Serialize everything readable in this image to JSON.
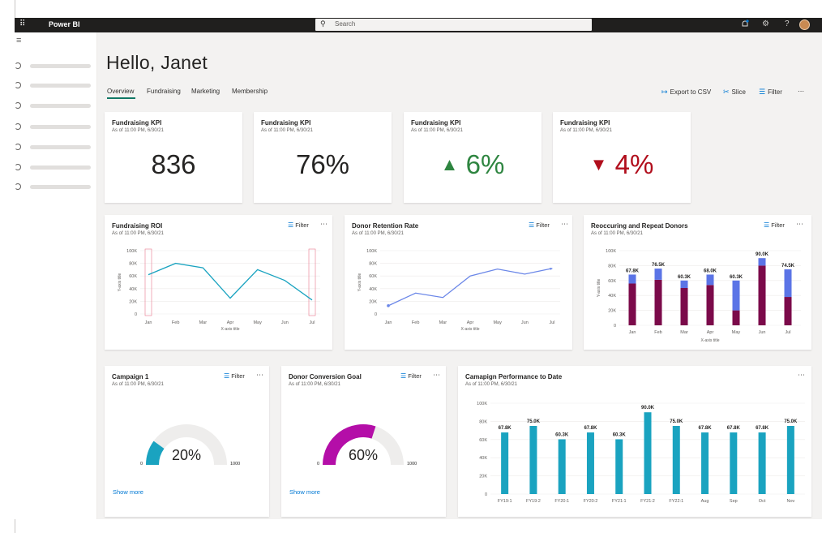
{
  "topbar": {
    "app_name": "Power BI",
    "search_placeholder": "Search",
    "icons": [
      "waffle-icon",
      "search-icon",
      "notification-icon",
      "settings-icon",
      "help-icon",
      "avatar"
    ]
  },
  "greeting": "Hello, Janet",
  "tabs": [
    {
      "label": "Overview",
      "active": true
    },
    {
      "label": "Fundraising",
      "active": false
    },
    {
      "label": "Marketing",
      "active": false
    },
    {
      "label": "Membership",
      "active": false
    }
  ],
  "actions": {
    "export": "Export to CSV",
    "slice": "Slice",
    "filter": "Filter",
    "more": "⋯"
  },
  "kpis": [
    {
      "title": "Fundraising KPI",
      "subtitle": "As of 11:00 PM, 6/30/21",
      "value": "836",
      "trend": "none",
      "color": "#252423"
    },
    {
      "title": "Fundraising KPI",
      "subtitle": "As of 11:00 PM, 6/30/21",
      "value": "76%",
      "trend": "none",
      "color": "#252423"
    },
    {
      "title": "Fundraising KPI",
      "subtitle": "As of 11:00 PM, 6/30/21",
      "value": "6%",
      "trend": "up",
      "arrow": "▲",
      "color": "#2e8540"
    },
    {
      "title": "Fundraising KPI",
      "subtitle": "As of 11:00 PM, 6/30/21",
      "value": "4%",
      "trend": "down",
      "arrow": "▼",
      "color": "#b10e1c"
    }
  ],
  "filter_label": "Filter",
  "show_more": "Show more",
  "chart_data": [
    {
      "type": "line",
      "title": "Fundraising ROI",
      "subtitle": "As of 11:00 PM, 6/30/21",
      "categories": [
        "Jan",
        "Feb",
        "Mar",
        "Apr",
        "May",
        "Jun",
        "Jul"
      ],
      "yticks": [
        "0",
        "20K",
        "40K",
        "60K",
        "80K",
        "100K"
      ],
      "ylim": [
        0,
        100
      ],
      "values": [
        62,
        80,
        73,
        25,
        70,
        53,
        22
      ],
      "color": "#1aa3c0",
      "xlabel": "X-axis title",
      "ylabel": "Y-axis title"
    },
    {
      "type": "line",
      "title": "Donor Retention Rate",
      "subtitle": "As of 11:00 PM, 6/30/21",
      "categories": [
        "Jan",
        "Feb",
        "Mar",
        "Apr",
        "May",
        "Jun",
        "Jul"
      ],
      "yticks": [
        "0",
        "20K",
        "40K",
        "60K",
        "80K",
        "100K"
      ],
      "ylim": [
        0,
        100
      ],
      "values": [
        13,
        33,
        26,
        60,
        71,
        63,
        72
      ],
      "color": "#6b87e8",
      "xlabel": "X-axis title",
      "ylabel": "Y-axis title"
    },
    {
      "type": "bar",
      "title": "Reoccuring and Repeat Donors",
      "subtitle": "As of 11:00 PM, 6/30/21",
      "categories": [
        "Jan",
        "Feb",
        "Mar",
        "Apr",
        "May",
        "Jun",
        "Jul"
      ],
      "yticks": [
        "0",
        "20K",
        "40K",
        "60K",
        "80K",
        "100K"
      ],
      "ylim": [
        0,
        100
      ],
      "series": [
        {
          "values": [
            56,
            61,
            50,
            54,
            20,
            80,
            38
          ],
          "color": "#7b0a4a"
        },
        {
          "values": [
            12,
            15,
            10,
            14,
            40,
            10,
            37
          ],
          "color": "#5b74e6"
        }
      ],
      "labels": [
        "67.8K",
        "76.5K",
        "60.3K",
        "68.0K",
        "60.3K",
        "90.0K",
        "74.5K"
      ],
      "xlabel": "X-axis title",
      "ylabel": "Y-axis title"
    },
    {
      "type": "gauge",
      "title": "Campaign 1",
      "subtitle": "As of 11:00 PM, 6/30/21",
      "value": 20,
      "label": "20%",
      "min": "0",
      "max": "1000",
      "color": "#1aa3c0"
    },
    {
      "type": "gauge",
      "title": "Donor Conversion Goal",
      "subtitle": "As of 11:00 PM, 6/30/21",
      "value": 60,
      "label": "60%",
      "min": "0",
      "max": "1000",
      "color": "#b40ea8"
    },
    {
      "type": "bar",
      "title": "Camapign Performance to Date",
      "subtitle": "As of 11:00 PM, 6/30/21",
      "categories": [
        "FY19:1",
        "FY19:2",
        "FY20:1",
        "FY20:2",
        "FY21:1",
        "FY21:2",
        "FY22:1",
        "Aug",
        "Sep",
        "Oct",
        "Nov"
      ],
      "yticks": [
        "0",
        "20K",
        "40K",
        "60K",
        "80K",
        "100K"
      ],
      "ylim": [
        0,
        100
      ],
      "values": [
        67.8,
        75.0,
        60.3,
        67.8,
        60.3,
        90.0,
        75.0,
        67.8,
        67.8,
        67.8,
        75.0
      ],
      "labels": [
        "67.8K",
        "75.0K",
        "60.3K",
        "67.8K",
        "60.3K",
        "90.0K",
        "75.0K",
        "67.8K",
        "67.8K",
        "67.8K",
        "75.0K"
      ],
      "color": "#1aa3c0"
    }
  ]
}
